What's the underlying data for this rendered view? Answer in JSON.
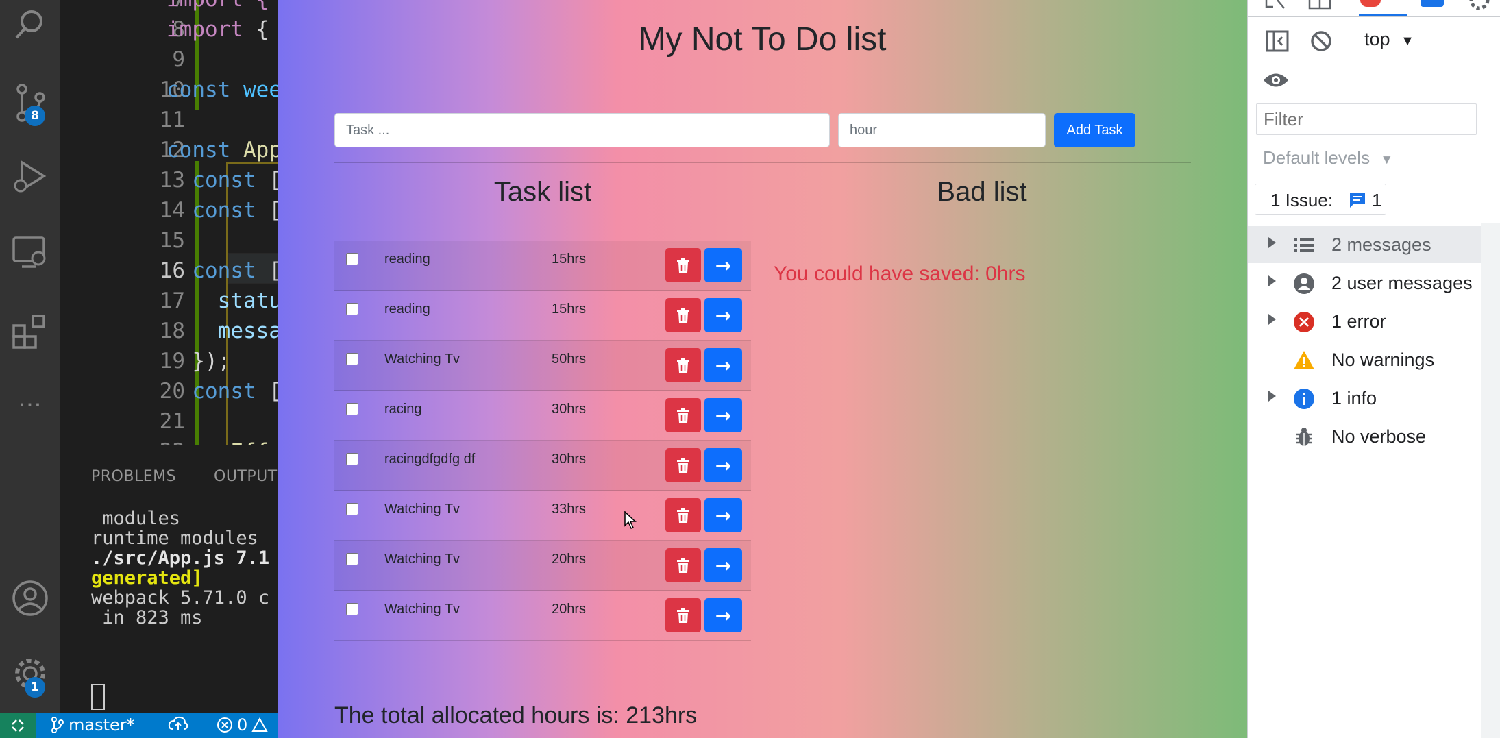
{
  "vscode": {
    "activity_badges": {
      "source_control": "8",
      "settings": "1"
    },
    "editor": {
      "lines": [
        {
          "num": "7",
          "segments": [
            {
              "t": "import {",
              "c": "im"
            }
          ]
        },
        {
          "num": "8",
          "segments": [
            {
              "t": "import",
              "c": "im"
            },
            {
              "t": " {",
              "c": "pl"
            }
          ]
        },
        {
          "num": "9",
          "segments": []
        },
        {
          "num": "10",
          "segments": [
            {
              "t": "const",
              "c": "kw"
            },
            {
              "t": " wee",
              "c": "id"
            }
          ]
        },
        {
          "num": "11",
          "segments": []
        },
        {
          "num": "12",
          "segments": [
            {
              "t": "const",
              "c": "kw"
            },
            {
              "t": " App",
              "c": "fn"
            }
          ]
        },
        {
          "num": "13",
          "segments": [
            {
              "t": "  const",
              "c": "kw"
            },
            {
              "t": " [",
              "c": "pl"
            }
          ]
        },
        {
          "num": "14",
          "segments": [
            {
              "t": "  const",
              "c": "kw"
            },
            {
              "t": " [",
              "c": "pl"
            }
          ]
        },
        {
          "num": "15",
          "segments": []
        },
        {
          "num": "16",
          "segments": [
            {
              "t": "  const",
              "c": "kw"
            },
            {
              "t": " [",
              "c": "pl"
            }
          ]
        },
        {
          "num": "17",
          "segments": [
            {
              "t": "    statu",
              "c": "pr"
            }
          ]
        },
        {
          "num": "18",
          "segments": [
            {
              "t": "    messa",
              "c": "pr"
            }
          ]
        },
        {
          "num": "19",
          "segments": [
            {
              "t": "  });",
              "c": "pl"
            }
          ]
        },
        {
          "num": "20",
          "segments": [
            {
              "t": "  const",
              "c": "kw"
            },
            {
              "t": " [",
              "c": "pl"
            }
          ]
        },
        {
          "num": "21",
          "segments": []
        },
        {
          "num": "22",
          "segments": [
            {
              "t": "  useEffe",
              "c": "fn"
            }
          ]
        }
      ]
    },
    "panel": {
      "tabs": [
        "PROBLEMS",
        "OUTPUT"
      ],
      "terminal_lines": [
        {
          "text": " modules",
          "style": ""
        },
        {
          "text": "runtime modules",
          "style": ""
        },
        {
          "text": "./src/App.js 7.1",
          "style": "bold"
        },
        {
          "text": "generated]",
          "style": "yellow"
        },
        {
          "text": "webpack 5.71.0 c",
          "style": ""
        },
        {
          "text": " in 823 ms",
          "style": ""
        }
      ]
    },
    "statusbar": {
      "branch": "master*",
      "errors": "0"
    }
  },
  "app": {
    "title": "My Not To Do list",
    "task_placeholder": "Task ...",
    "hour_placeholder": "hour",
    "add_button": "Add Task",
    "task_list_title": "Task list",
    "bad_list_title": "Bad list",
    "tasks": [
      {
        "name": "reading",
        "hours": "15hrs"
      },
      {
        "name": "reading",
        "hours": "15hrs"
      },
      {
        "name": "Watching Tv",
        "hours": "50hrs"
      },
      {
        "name": "racing",
        "hours": "30hrs"
      },
      {
        "name": "racingdfgdfg df",
        "hours": "30hrs"
      },
      {
        "name": "Watching Tv",
        "hours": "33hrs"
      },
      {
        "name": "Watching Tv",
        "hours": "20hrs"
      },
      {
        "name": "Watching Tv",
        "hours": "20hrs"
      }
    ],
    "saved_text": "You could have saved: 0hrs",
    "total_text": "The total allocated hours is: 213hrs",
    "colors": {
      "primary": "#0d6efd",
      "danger": "#dc3545"
    }
  },
  "devtools": {
    "context": "top",
    "filter_placeholder": "Filter",
    "levels": "Default levels",
    "issues_label": "1 Issue:",
    "issues_count": "1",
    "messages": [
      {
        "label": "2 messages",
        "icon": "list-icon",
        "expandable": true,
        "selected": true
      },
      {
        "label": "2 user messages",
        "icon": "user-icon",
        "expandable": true,
        "selected": false
      },
      {
        "label": "1 error",
        "icon": "error-icon",
        "expandable": true,
        "selected": false
      },
      {
        "label": "No warnings",
        "icon": "warning-icon",
        "expandable": false,
        "selected": false
      },
      {
        "label": "1 info",
        "icon": "info-icon",
        "expandable": true,
        "selected": false
      },
      {
        "label": "No verbose",
        "icon": "bug-icon",
        "expandable": false,
        "selected": false
      }
    ]
  }
}
